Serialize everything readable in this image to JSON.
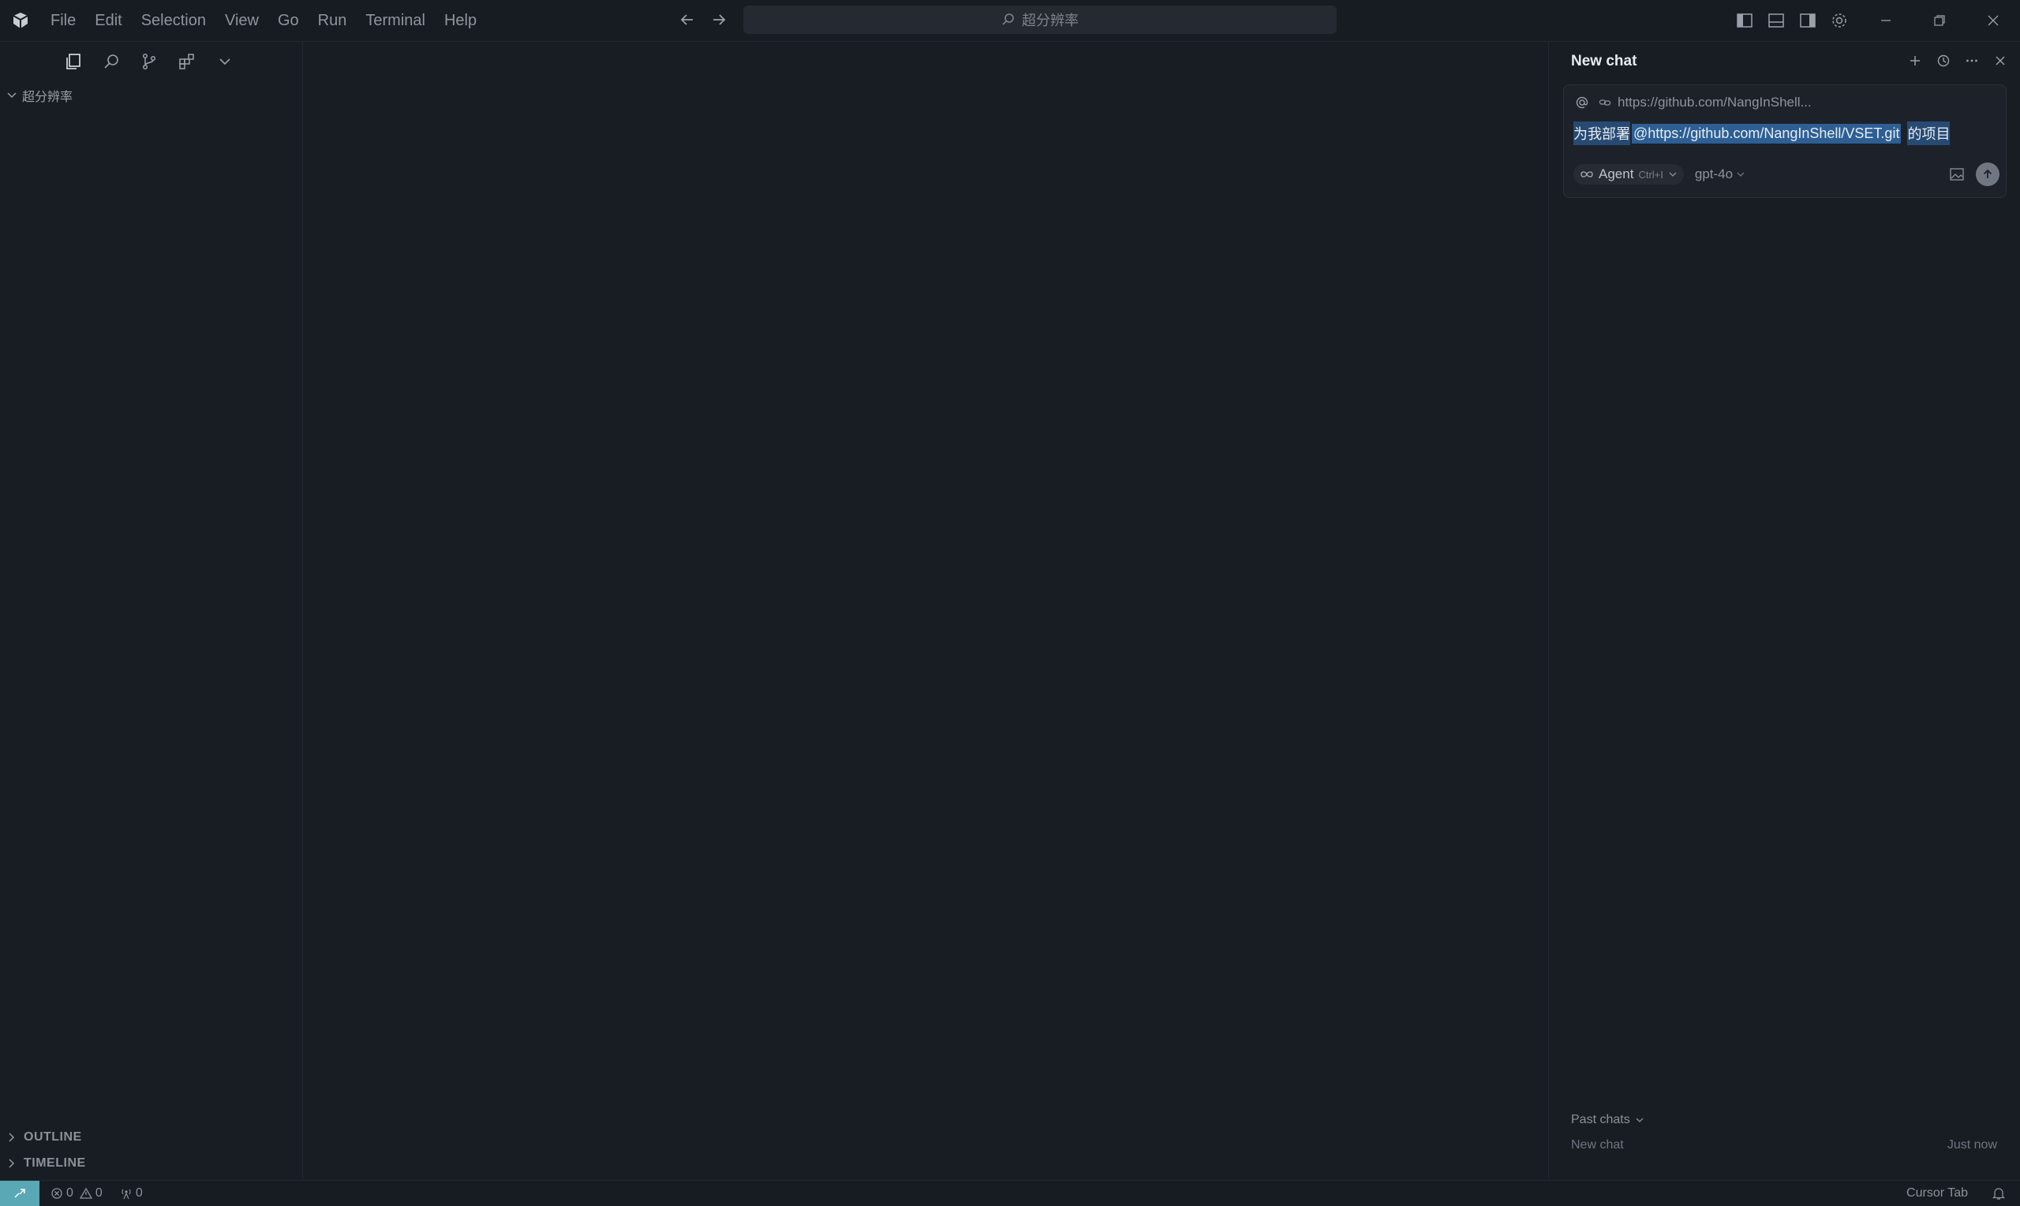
{
  "titlebar": {
    "menu": [
      "File",
      "Edit",
      "Selection",
      "View",
      "Go",
      "Run",
      "Terminal",
      "Help"
    ],
    "search_text": "超分辨率"
  },
  "sidebar": {
    "folder_name": "超分辨率",
    "sections": {
      "outline": "OUTLINE",
      "timeline": "TIMELINE"
    }
  },
  "chat": {
    "title": "New chat",
    "context_link": "https://github.com/NangInShell...",
    "prompt": {
      "before": "为我部署",
      "mention": "@https://github.com/NangInShell/VSET.git",
      "after": "的项目"
    },
    "mode": "Agent",
    "mode_shortcut": "Ctrl+I",
    "model": "gpt-4o",
    "past_chats_label": "Past chats",
    "past_chats": [
      {
        "title": "New chat",
        "time": "Just now"
      }
    ]
  },
  "statusbar": {
    "errors": "0",
    "warnings": "0",
    "ports": "0",
    "right_label": "Cursor Tab"
  },
  "colors": {
    "background": "#181c23",
    "remote_indicator": "#5aa7b5",
    "mention_highlight": "#2d5f94"
  }
}
